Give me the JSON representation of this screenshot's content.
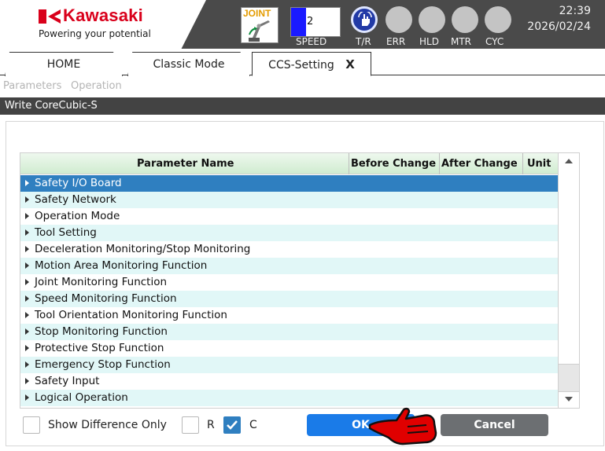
{
  "header": {
    "brand": "Kawasaki",
    "tagline": "Powering your potential",
    "mode_label": "JOINT",
    "speed": {
      "value": "2",
      "label": "SPEED",
      "level_fraction": 0.3
    },
    "lamps": [
      {
        "label": "T/R",
        "state": "active"
      },
      {
        "label": "ERR",
        "state": "off"
      },
      {
        "label": "HLD",
        "state": "off"
      },
      {
        "label": "MTR",
        "state": "off"
      },
      {
        "label": "CYC",
        "state": "off"
      }
    ],
    "time": "22:39",
    "date": "2026/02/24"
  },
  "tabs": [
    {
      "label": "HOME"
    },
    {
      "label": "Classic Mode"
    },
    {
      "label": "CCS-Setting",
      "close": "X",
      "active": true
    }
  ],
  "menu": {
    "items": [
      "Parameters",
      "Operation"
    ]
  },
  "title": "Write CoreCubic-S",
  "table": {
    "headers": {
      "name": "Parameter Name",
      "before": "Before Change",
      "after": "After Change",
      "unit": "Unit"
    },
    "rows": [
      "Safety I/O Board",
      "Safety Network",
      "Operation Mode",
      "Tool Setting",
      "Deceleration Monitoring/Stop Monitoring",
      "Motion Area Monitoring Function",
      "Joint Monitoring Function",
      "Speed Monitoring Function",
      "Tool Orientation Monitoring Function",
      "Stop Monitoring Function",
      "Protective Stop Function",
      "Emergency Stop Function",
      "Safety Input",
      "Logical Operation"
    ],
    "selected_index": 0
  },
  "footer": {
    "show_diff_label": "Show Difference Only",
    "r_label": "R",
    "c_label": "C",
    "ok_label": "OK",
    "cancel_label": "Cancel"
  },
  "colors": {
    "brand_red": "#d9001b",
    "accent_blue": "#1a7be8",
    "select_blue": "#2f7fc0",
    "row_alt": "#e1f7f7"
  }
}
